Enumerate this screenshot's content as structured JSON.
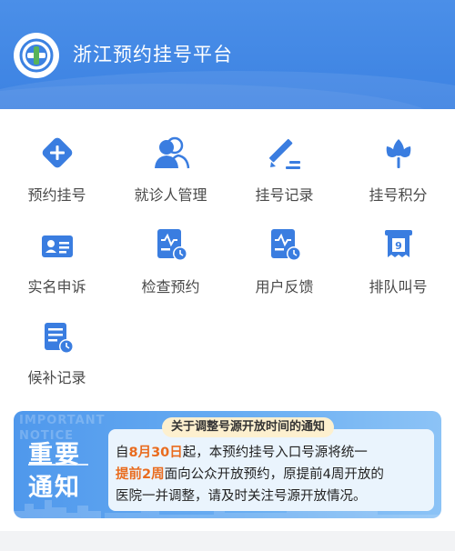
{
  "header": {
    "title": "浙江预约挂号平台",
    "logo_icon": "hospital-cross-logo-icon",
    "background": "#3c82e2"
  },
  "menu": {
    "icon_color": "#3a7de0",
    "items": [
      {
        "label": "预约挂号",
        "icon": "plus-diamond-icon"
      },
      {
        "label": "就诊人管理",
        "icon": "people-icon"
      },
      {
        "label": "挂号记录",
        "icon": "pen-record-icon"
      },
      {
        "label": "挂号积分",
        "icon": "lotus-icon"
      },
      {
        "label": "实名申诉",
        "icon": "id-card-icon"
      },
      {
        "label": "检查预约",
        "icon": "report-clock-icon"
      },
      {
        "label": "用户反馈",
        "icon": "chart-clock-icon"
      },
      {
        "label": "排队叫号",
        "icon": "queue-ticket-icon"
      },
      {
        "label": "候补记录",
        "icon": "list-clock-icon"
      }
    ]
  },
  "notice": {
    "bg_word_1": "IMPORTANT",
    "bg_word_2": "NOTICE",
    "big_line_1": "重要",
    "big_line_2": "通知",
    "tag": "关于调整号源开放时间的通知",
    "body": {
      "p1": "自",
      "date": "8月30日",
      "p2": "起，本预约挂号入口号源将统一",
      "early": "提前2周",
      "p3": "面向公众开放预约，原提前4周开放的",
      "p4": "医院一并调整，请及时关注号源开放情况。"
    },
    "highlight_color": "#e96c1f"
  }
}
